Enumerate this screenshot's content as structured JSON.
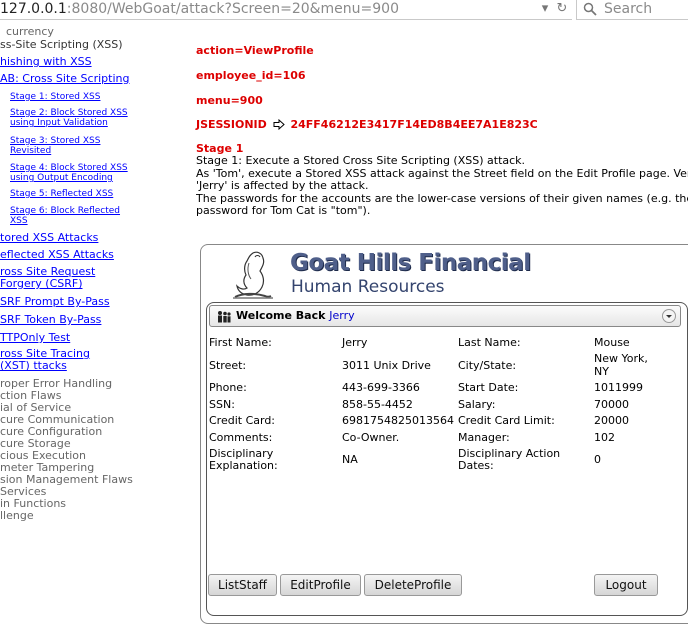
{
  "browser": {
    "url_host": "127.0.0.1",
    "url_rest": ":8080/WebGoat/attack?Screen=20&menu=900",
    "search_placeholder": "Search",
    "icons": [
      "dropdown-arrow-icon",
      "reload-icon",
      "search-icon"
    ]
  },
  "nav": {
    "items": [
      {
        "label": "currency",
        "style": "l1"
      },
      {
        "label": "ss-Site Scripting (XSS)",
        "style": "l1b"
      },
      {
        "label": "hishing with XSS",
        "style": "lk"
      },
      {
        "label": "AB: Cross Site Scripting",
        "style": "lk"
      },
      {
        "label": "Stage 1: Stored XSS",
        "style": "sub"
      },
      {
        "label": "Stage 2: Block Stored XSS using Input Validation",
        "style": "sub"
      },
      {
        "label": "Stage 3: Stored XSS Revisited",
        "style": "sub"
      },
      {
        "label": "Stage 4: Block Stored XSS using Output Encoding",
        "style": "sub"
      },
      {
        "label": "Stage 5: Reflected XSS",
        "style": "sub"
      },
      {
        "label": "Stage 6: Block Reflected XSS",
        "style": "sub"
      },
      {
        "label": "tored XSS Attacks",
        "style": "lk"
      },
      {
        "label": "eflected XSS Attacks",
        "style": "lk"
      },
      {
        "label": "ross Site Request Forgery (CSRF)",
        "style": "lk"
      },
      {
        "label": "SRF Prompt By-Pass",
        "style": "lk"
      },
      {
        "label": "SRF Token By-Pass",
        "style": "lk"
      },
      {
        "label": "TTPOnly Test",
        "style": "lk"
      },
      {
        "label": "ross Site Tracing (XST) ttacks",
        "style": "lk"
      }
    ],
    "sections": [
      "roper Error Handling",
      "ction Flaws",
      "ial of Service",
      "cure Communication",
      "cure Configuration",
      "cure Storage",
      "cious Execution",
      "meter Tampering",
      "sion Management Flaws",
      "Services",
      "in Functions",
      "llenge"
    ]
  },
  "params": {
    "action": "action=ViewProfile",
    "employee_id": "employee_id=106",
    "menu": "menu=900",
    "jsession_label": "JSESSIONID",
    "jsession_value": "24FF46212E3417F14ED8B4EE7A1E823C"
  },
  "stage": {
    "title": "Stage 1",
    "lines": [
      "Stage 1: Execute a Stored Cross Site Scripting (XSS) attack.",
      "As 'Tom', execute a Stored XSS attack against the Street field on the Edit Profile page. Verif",
      "'Jerry' is affected by the attack.",
      "The passwords for the accounts are the lower-case versions of their given names (e.g. the",
      "password for Tom Cat is \"tom\")."
    ]
  },
  "app": {
    "title_line1": "Goat Hills Financial",
    "title_line2": "Human Resources",
    "welcome_label": "Welcome Back",
    "welcome_name": "Jerry",
    "profile": {
      "first_name_label": "First Name:",
      "first_name": "Jerry",
      "last_name_label": "Last Name:",
      "last_name": "Mouse",
      "street_label": "Street:",
      "street": "3011 Unix Drive",
      "city_label": "City/State:",
      "city": "New York,",
      "state": "NY",
      "phone_label": "Phone:",
      "phone": "443-699-3366",
      "start_label": "Start Date:",
      "start": "1011999",
      "ssn_label": "SSN:",
      "ssn": "858-55-4452",
      "salary_label": "Salary:",
      "salary": "70000",
      "cc_label": "Credit Card:",
      "cc": "6981754825013564",
      "cclimit_label": "Credit Card Limit:",
      "cclimit": "20000",
      "comments_label": "Comments:",
      "comments": "Co-Owner.",
      "manager_label": "Manager:",
      "manager": "102",
      "disc_label_1": "Disciplinary",
      "disc_label_2": "Explanation:",
      "disc": "NA",
      "discdate_label_1": "Disciplinary Action",
      "discdate_label_2": "Dates:",
      "discdate": "0"
    },
    "buttons": {
      "list_staff": "ListStaff",
      "edit_profile": "EditProfile",
      "delete_profile": "DeleteProfile",
      "logout": "Logout"
    }
  },
  "colors": {
    "param_red": "#dd0000",
    "link_blue": "#0000ff",
    "title_blue": "#4f5f8a"
  }
}
